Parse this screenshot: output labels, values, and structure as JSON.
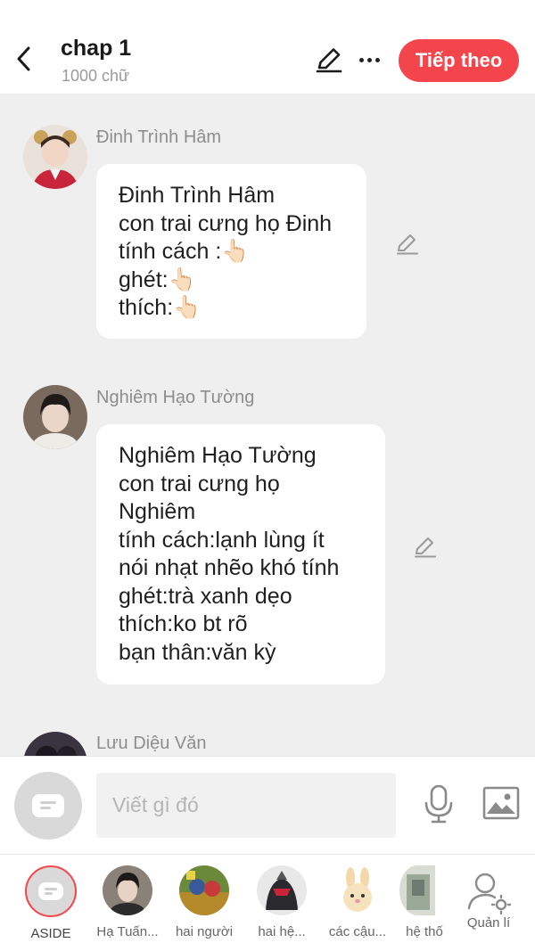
{
  "header": {
    "title": "chap 1",
    "subtitle": "1000 chữ",
    "next_label": "Tiếp theo"
  },
  "messages": [
    {
      "name": "Đinh Trình Hâm",
      "text": "Đinh Trình Hâm\ncon trai cưng họ Đinh\ntính cách :👆🏻\nghét:👆🏻\nthích:👆🏻"
    },
    {
      "name": "Nghiêm Hạo Tường",
      "text": "Nghiêm Hạo Tường\ncon trai cưng họ\nNghiêm\ntính cách:lạnh lùng ít\nnói nhạt nhẽo khó tính\nghét:trà xanh dẹo\nthích:ko bt rõ\nbạn thân:văn kỳ"
    },
    {
      "name": "Lưu Diệu Văn",
      "text": ""
    }
  ],
  "composer": {
    "placeholder": "Viết gì đó"
  },
  "bottom_bar": {
    "items": [
      {
        "label": "ASIDE"
      },
      {
        "label": "Hạ Tuấn..."
      },
      {
        "label": "hai người"
      },
      {
        "label": "hai hệ..."
      },
      {
        "label": "các cậu..."
      },
      {
        "label": "hệ thố"
      },
      {
        "label": "Quản lí"
      }
    ]
  },
  "colors": {
    "accent": "#f4454d",
    "background": "#efefef"
  }
}
